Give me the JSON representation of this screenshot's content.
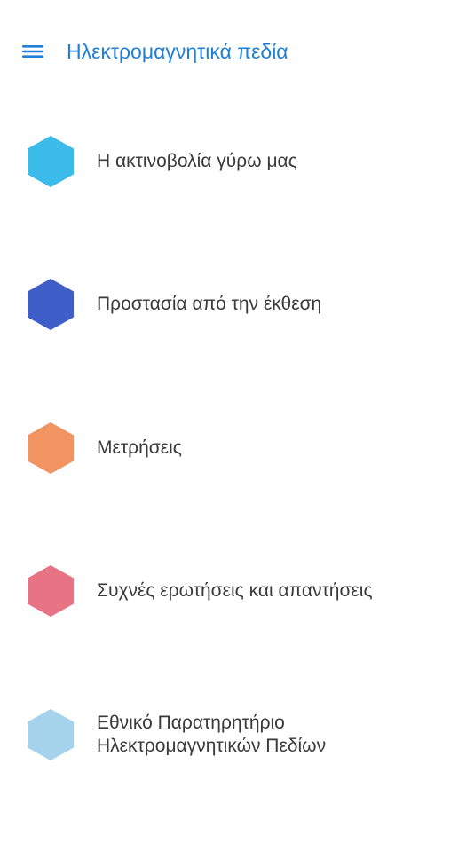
{
  "app_bar": {
    "title": "Ηλεκτρομαγνητικά πεδία",
    "menu_icon": "hamburger-menu-icon",
    "accent_color": "#1f7fd6"
  },
  "menu": {
    "items": [
      {
        "label": "Η ακτινοβολία γύρω μας",
        "icon": "hexagon-icon",
        "color": "#3bbbe9"
      },
      {
        "label": "Προστασία από την έκθεση",
        "icon": "hexagon-icon",
        "color": "#3f5ec7"
      },
      {
        "label": "Μετρήσεις",
        "icon": "hexagon-icon",
        "color": "#f29462"
      },
      {
        "label": "Συχνές ερωτήσεις και απαντήσεις",
        "icon": "hexagon-icon",
        "color": "#e77384"
      },
      {
        "label": "Εθνικό Παρατηρητήριο Ηλεκτρομαγνητικών Πεδίων",
        "icon": "hexagon-icon",
        "color": "#a5d3ec"
      }
    ]
  }
}
